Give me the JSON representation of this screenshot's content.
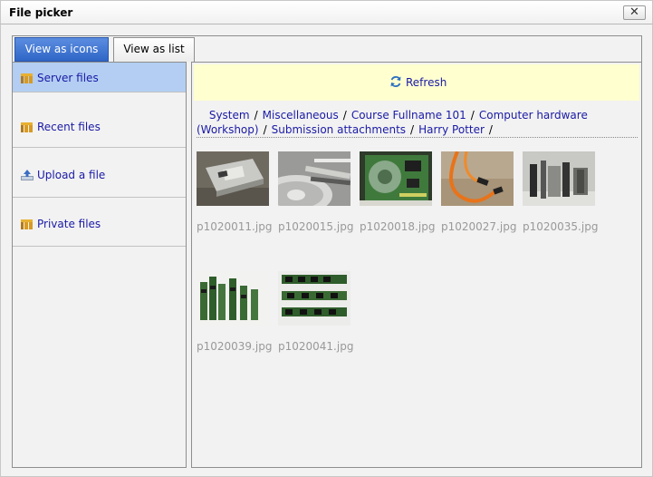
{
  "dialog": {
    "title": "File picker",
    "close_label": "✕"
  },
  "view_tabs": [
    {
      "label": "View as icons",
      "active": true
    },
    {
      "label": "View as list",
      "active": false
    }
  ],
  "repositories": [
    {
      "label": "Server files",
      "icon": "server-files-icon",
      "selected": true
    },
    {
      "label": "Recent files",
      "icon": "recent-files-icon",
      "selected": false
    },
    {
      "label": "Upload a file",
      "icon": "upload-file-icon",
      "selected": false
    },
    {
      "label": "Private files",
      "icon": "private-files-icon",
      "selected": false
    }
  ],
  "toolbar": {
    "refresh_label": "Refresh",
    "icon": "refresh-icon"
  },
  "breadcrumb": [
    "System",
    "Miscellaneous",
    "Course Fullname 101",
    "Computer hardware (Workshop)",
    "Submission attachments",
    "Harry Potter"
  ],
  "breadcrumb_separator": "/",
  "files": [
    {
      "name": "p1020011.jpg",
      "thumb": "hard-drive-photo"
    },
    {
      "name": "p1020015.jpg",
      "thumb": "disk-platter-photo"
    },
    {
      "name": "p1020018.jpg",
      "thumb": "circuit-board-photo"
    },
    {
      "name": "p1020027.jpg",
      "thumb": "orange-sata-cable-photo"
    },
    {
      "name": "p1020035.jpg",
      "thumb": "memory-modules-standing-photo"
    },
    {
      "name": "p1020039.jpg",
      "thumb": "ram-sticks-on-white-photo"
    },
    {
      "name": "p1020041.jpg",
      "thumb": "ram-modules-rows-photo"
    }
  ],
  "colors": {
    "link": "#1a1aa6",
    "selected_bg": "#b3cef2",
    "refresh_bg": "#ffffd0",
    "tab_active": "#3a72d4",
    "filename": "#999999"
  }
}
